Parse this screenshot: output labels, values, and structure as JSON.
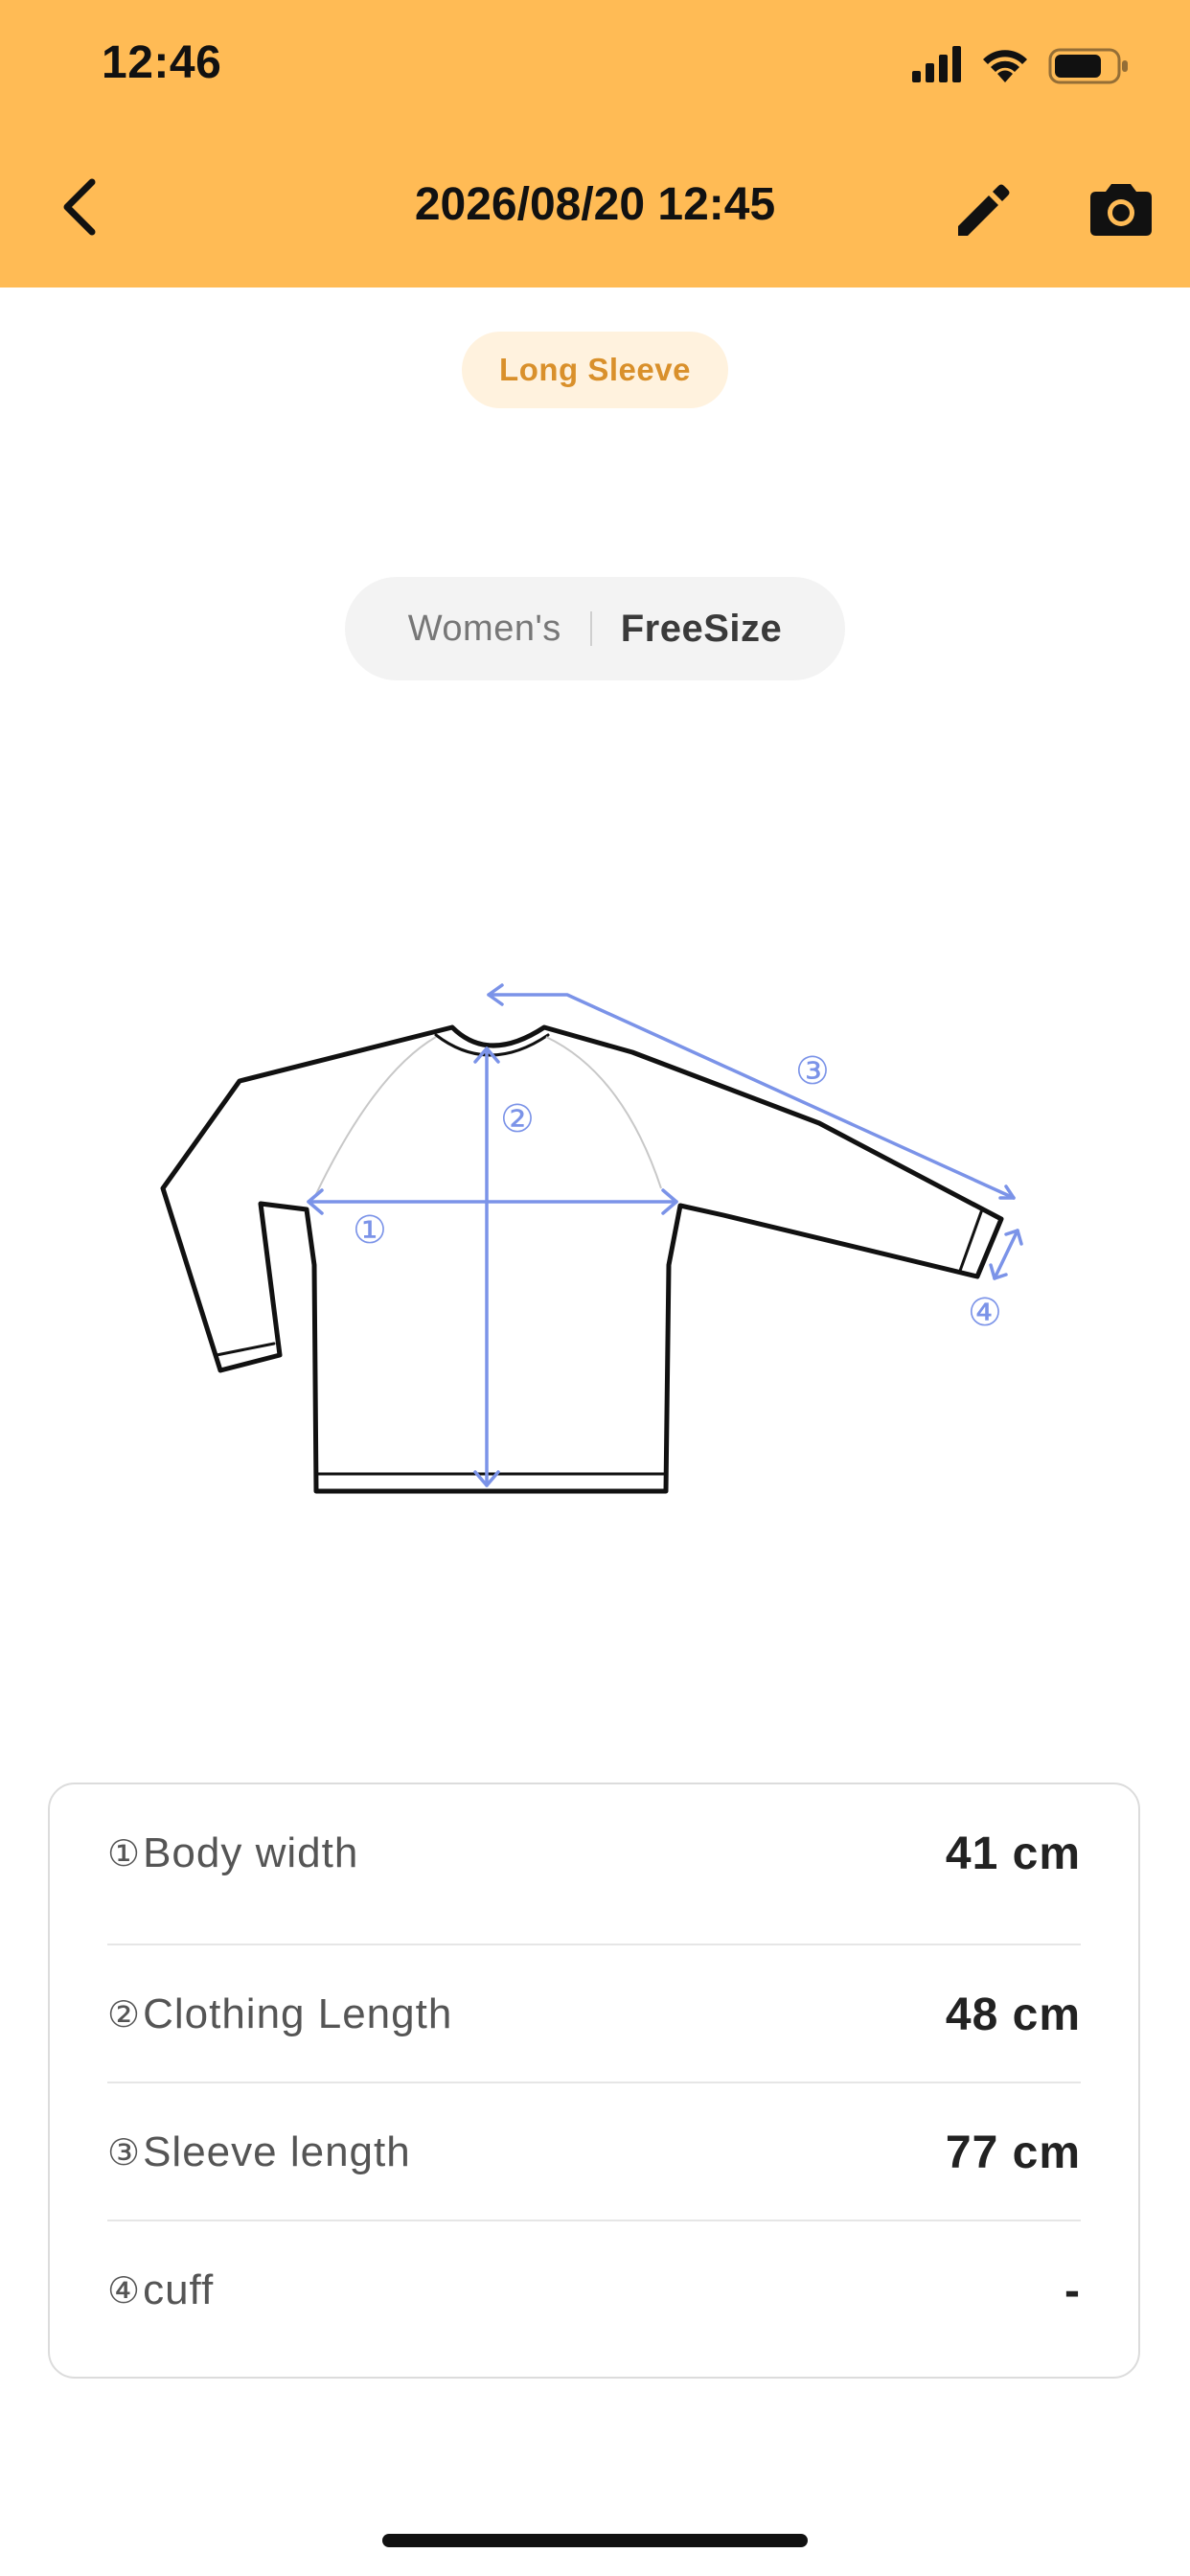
{
  "status_bar": {
    "time": "12:46"
  },
  "nav": {
    "title": "2026/08/20 12:45",
    "back_icon": "chevron-left-icon",
    "edit_icon": "pencil-icon",
    "camera_icon": "camera-icon"
  },
  "item": {
    "category": "Long Sleeve",
    "gender": "Women's",
    "size": "FreeSize"
  },
  "diagram": {
    "markers": [
      "①",
      "②",
      "③",
      "④"
    ]
  },
  "measurements": [
    {
      "num": "①",
      "label": "Body width",
      "value": "41 cm"
    },
    {
      "num": "②",
      "label": "Clothing Length",
      "value": "48 cm"
    },
    {
      "num": "③",
      "label": "Sleeve length",
      "value": "77 cm"
    },
    {
      "num": "④",
      "label": "cuff",
      "value": "-"
    }
  ],
  "colors": {
    "header": "#FFBB55",
    "badge_bg": "#FFF2DE",
    "badge_text": "#D9902B",
    "measure_lines": "#7B93E8"
  }
}
